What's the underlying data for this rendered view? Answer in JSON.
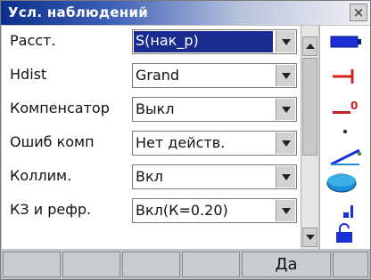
{
  "window": {
    "title": "Усл. наблюдений",
    "close_glyph": "×"
  },
  "settings": [
    {
      "label": "Расст.",
      "value": "S(нак_р)",
      "selected": true
    },
    {
      "label": "Hdist",
      "value": "Grand",
      "selected": false
    },
    {
      "label": "Компенсатор",
      "value": "Выкл",
      "selected": false
    },
    {
      "label": "Ошиб комп",
      "value": "Нет действ.",
      "selected": false
    },
    {
      "label": "Коллим.",
      "value": "Вкл",
      "selected": false
    },
    {
      "label": "КЗ и рефр.",
      "value": "Вкл(К=0.20)",
      "selected": false
    }
  ],
  "softkeys": [
    "",
    "",
    "",
    "",
    "Да",
    ""
  ],
  "status_icons": [
    {
      "name": "battery-icon",
      "color": "#1a2fd6"
    },
    {
      "name": "target-icon",
      "color": "#d42020"
    },
    {
      "name": "prism-constant-icon",
      "color": "#c02020",
      "text": "0"
    },
    {
      "name": "tilt-icon",
      "color": "#1a2fd6"
    },
    {
      "name": "disk-icon",
      "color": "#1a8fd6"
    },
    {
      "name": "signal-icon",
      "color": "#1a2fd6"
    }
  ],
  "colors": {
    "title_start": "#0b2f8a",
    "selection": "#1a2c8f",
    "accent_blue": "#1a2fd6"
  }
}
